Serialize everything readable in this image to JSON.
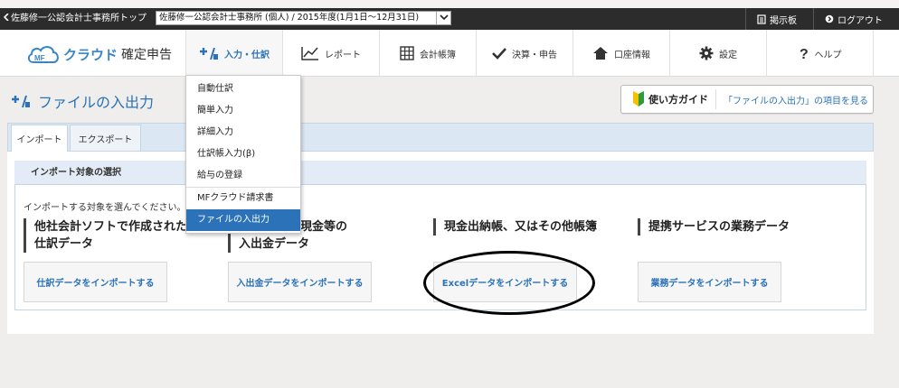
{
  "topbar": {
    "back_label": "佐藤修一公認会計士事務所トップ",
    "office_select_value": "佐藤修一公認会計士事務所 (個人) / 2015年度(1月1日～12月31日)",
    "notice_label": "掲示板",
    "logout_label": "ログアウト"
  },
  "header": {
    "logo_mf": "MF",
    "logo_cloud": "クラウド",
    "logo_product": "確定申告",
    "nav": [
      {
        "label": "入力・仕訳",
        "icon": "journal-entry-icon"
      },
      {
        "label": "レポート",
        "icon": "report-chart-icon"
      },
      {
        "label": "会計帳簿",
        "icon": "ledger-grid-icon"
      },
      {
        "label": "決算・申告",
        "icon": "check-icon"
      },
      {
        "label": "口座情報",
        "icon": "home-icon"
      },
      {
        "label": "設定",
        "icon": "gear-icon"
      },
      {
        "label": "ヘルプ",
        "icon": "question-icon"
      }
    ]
  },
  "dropdown": {
    "items": [
      "自動仕訳",
      "簡単入力",
      "詳細入力",
      "仕訳帳入力(β)",
      "給与の登録",
      "MFクラウド請求書",
      "ファイルの入出力"
    ],
    "selected": "ファイルの入出力"
  },
  "page": {
    "title": "ファイルの入出力",
    "guide_label": "使い方ガイド",
    "guide_link": "「ファイルの入出力」の項目を見る",
    "tabs": [
      "インポート",
      "エクスポート"
    ],
    "section_title": "インポート対象の選択",
    "instruction": "インポートする対象を選んでください。",
    "categories": [
      {
        "line1": "他社会計ソフトで作成された",
        "line2": "仕訳データ",
        "button": "仕訳データをインポートする"
      },
      {
        "line1": "現金等の",
        "line2": "入出金データ",
        "button": "入出金データをインポートする"
      },
      {
        "line1": "現金出納帳、又はその他帳簿",
        "line2": "",
        "button": "Excelデータをインポートする"
      },
      {
        "line1": "提携サービスの業務データ",
        "line2": "",
        "button": "業務データをインポートする"
      }
    ]
  },
  "colors": {
    "accent": "#2b72b8",
    "topbar": "#2c2c2c",
    "panel": "#dbe8f4",
    "annotation": "#000000"
  }
}
